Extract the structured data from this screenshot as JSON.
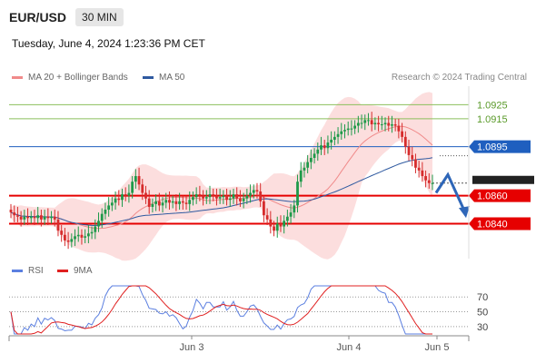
{
  "header": {
    "symbol": "EUR/USD",
    "timeframe": "30 MIN",
    "datetime": "Tuesday, June 4, 2024 1:23:36 PM CET"
  },
  "legend_top": {
    "ma20": "MA 20 + Bollinger Bands",
    "ma50": "MA 50",
    "credit": "Research © 2024 Trading Central"
  },
  "legend_bottom": {
    "rsi": "RSI",
    "ma9": "9MA"
  },
  "colors": {
    "ma20": "#f08a8a",
    "ma50": "#2f5aa0",
    "bands": "#fbd3d3",
    "up": "#1e9a4a",
    "down": "#d62c2c",
    "support": "#e60000",
    "resistance": "#1f5fbf",
    "target_green": "#8bbf5c",
    "rsi": "#5b7fe0",
    "rsi_ma": "#e02020"
  },
  "chart_data": [
    {
      "type": "candlestick",
      "ylim": [
        1.0815,
        1.0935
      ],
      "x_ticks": [
        "Jun 3",
        "Jun 4",
        "Jun 5"
      ],
      "levels": [
        {
          "value": 1.0925,
          "label": "1.0925",
          "kind": "target",
          "color": "#8bbf5c"
        },
        {
          "value": 1.0915,
          "label": "1.0915",
          "kind": "target",
          "color": "#8bbf5c"
        },
        {
          "value": 1.0895,
          "label": "1.0895",
          "kind": "resistance",
          "color": "#1f5fbf"
        },
        {
          "value": 1.086,
          "label": "1.0860",
          "kind": "support",
          "color": "#e60000"
        },
        {
          "value": 1.084,
          "label": "1.0840",
          "kind": "support",
          "color": "#e60000"
        }
      ],
      "current_price_label": "1.0860",
      "close_series": [
        1.0848,
        1.0846,
        1.0845,
        1.0843,
        1.0845,
        1.0844,
        1.0845,
        1.0844,
        1.0846,
        1.0843,
        1.0845,
        1.0844,
        1.0845,
        1.0843,
        1.0835,
        1.0832,
        1.0828,
        1.0827,
        1.0829,
        1.0831,
        1.0832,
        1.083,
        1.0831,
        1.0833,
        1.0834,
        1.0838,
        1.0842,
        1.0847,
        1.085,
        1.0853,
        1.0855,
        1.0858,
        1.0857,
        1.0861,
        1.086,
        1.0862,
        1.087,
        1.0874,
        1.0868,
        1.0862,
        1.0858,
        1.0852,
        1.0854,
        1.0856,
        1.0853,
        1.0855,
        1.0857,
        1.0855,
        1.0856,
        1.0854,
        1.0856,
        1.0855,
        1.0854,
        1.0857,
        1.0859,
        1.0861,
        1.086,
        1.0858,
        1.0859,
        1.0861,
        1.086,
        1.0858,
        1.0859,
        1.086,
        1.0857,
        1.0858,
        1.0861,
        1.0858,
        1.0856,
        1.0858,
        1.086,
        1.0862,
        1.0864,
        1.0863,
        1.0856,
        1.0846,
        1.0843,
        1.0838,
        1.0835,
        1.084,
        1.0838,
        1.0842,
        1.0845,
        1.0848,
        1.0853,
        1.087,
        1.0878,
        1.088,
        1.0884,
        1.0887,
        1.089,
        1.0893,
        1.0896,
        1.0894,
        1.0898,
        1.09,
        1.0902,
        1.0904,
        1.0906,
        1.0907,
        1.0908,
        1.0908,
        1.091,
        1.0912,
        1.0912,
        1.0914,
        1.0914,
        1.0911,
        1.0912,
        1.0911,
        1.0911,
        1.0912,
        1.091,
        1.0911,
        1.091,
        1.0906,
        1.0902,
        1.0895,
        1.0889,
        1.0886,
        1.088,
        1.0878,
        1.0874,
        1.0871,
        1.0869,
        1.0869
      ],
      "projection": [
        1.0862,
        1.0875,
        1.0848
      ]
    },
    {
      "type": "line",
      "title": "RSI",
      "y_ticks": [
        70,
        50,
        30
      ],
      "ylim": [
        20,
        85
      ]
    }
  ]
}
